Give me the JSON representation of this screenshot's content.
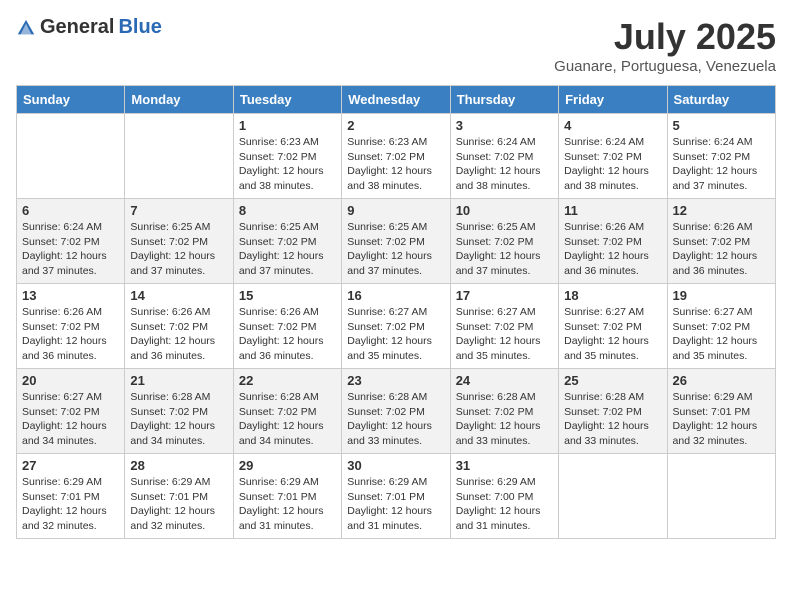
{
  "header": {
    "logo_general": "General",
    "logo_blue": "Blue",
    "month_title": "July 2025",
    "location": "Guanare, Portuguesa, Venezuela"
  },
  "days_of_week": [
    "Sunday",
    "Monday",
    "Tuesday",
    "Wednesday",
    "Thursday",
    "Friday",
    "Saturday"
  ],
  "weeks": [
    [
      {
        "day": "",
        "sunrise": "",
        "sunset": "",
        "daylight": ""
      },
      {
        "day": "",
        "sunrise": "",
        "sunset": "",
        "daylight": ""
      },
      {
        "day": "1",
        "sunrise": "Sunrise: 6:23 AM",
        "sunset": "Sunset: 7:02 PM",
        "daylight": "Daylight: 12 hours and 38 minutes."
      },
      {
        "day": "2",
        "sunrise": "Sunrise: 6:23 AM",
        "sunset": "Sunset: 7:02 PM",
        "daylight": "Daylight: 12 hours and 38 minutes."
      },
      {
        "day": "3",
        "sunrise": "Sunrise: 6:24 AM",
        "sunset": "Sunset: 7:02 PM",
        "daylight": "Daylight: 12 hours and 38 minutes."
      },
      {
        "day": "4",
        "sunrise": "Sunrise: 6:24 AM",
        "sunset": "Sunset: 7:02 PM",
        "daylight": "Daylight: 12 hours and 38 minutes."
      },
      {
        "day": "5",
        "sunrise": "Sunrise: 6:24 AM",
        "sunset": "Sunset: 7:02 PM",
        "daylight": "Daylight: 12 hours and 37 minutes."
      }
    ],
    [
      {
        "day": "6",
        "sunrise": "Sunrise: 6:24 AM",
        "sunset": "Sunset: 7:02 PM",
        "daylight": "Daylight: 12 hours and 37 minutes."
      },
      {
        "day": "7",
        "sunrise": "Sunrise: 6:25 AM",
        "sunset": "Sunset: 7:02 PM",
        "daylight": "Daylight: 12 hours and 37 minutes."
      },
      {
        "day": "8",
        "sunrise": "Sunrise: 6:25 AM",
        "sunset": "Sunset: 7:02 PM",
        "daylight": "Daylight: 12 hours and 37 minutes."
      },
      {
        "day": "9",
        "sunrise": "Sunrise: 6:25 AM",
        "sunset": "Sunset: 7:02 PM",
        "daylight": "Daylight: 12 hours and 37 minutes."
      },
      {
        "day": "10",
        "sunrise": "Sunrise: 6:25 AM",
        "sunset": "Sunset: 7:02 PM",
        "daylight": "Daylight: 12 hours and 37 minutes."
      },
      {
        "day": "11",
        "sunrise": "Sunrise: 6:26 AM",
        "sunset": "Sunset: 7:02 PM",
        "daylight": "Daylight: 12 hours and 36 minutes."
      },
      {
        "day": "12",
        "sunrise": "Sunrise: 6:26 AM",
        "sunset": "Sunset: 7:02 PM",
        "daylight": "Daylight: 12 hours and 36 minutes."
      }
    ],
    [
      {
        "day": "13",
        "sunrise": "Sunrise: 6:26 AM",
        "sunset": "Sunset: 7:02 PM",
        "daylight": "Daylight: 12 hours and 36 minutes."
      },
      {
        "day": "14",
        "sunrise": "Sunrise: 6:26 AM",
        "sunset": "Sunset: 7:02 PM",
        "daylight": "Daylight: 12 hours and 36 minutes."
      },
      {
        "day": "15",
        "sunrise": "Sunrise: 6:26 AM",
        "sunset": "Sunset: 7:02 PM",
        "daylight": "Daylight: 12 hours and 36 minutes."
      },
      {
        "day": "16",
        "sunrise": "Sunrise: 6:27 AM",
        "sunset": "Sunset: 7:02 PM",
        "daylight": "Daylight: 12 hours and 35 minutes."
      },
      {
        "day": "17",
        "sunrise": "Sunrise: 6:27 AM",
        "sunset": "Sunset: 7:02 PM",
        "daylight": "Daylight: 12 hours and 35 minutes."
      },
      {
        "day": "18",
        "sunrise": "Sunrise: 6:27 AM",
        "sunset": "Sunset: 7:02 PM",
        "daylight": "Daylight: 12 hours and 35 minutes."
      },
      {
        "day": "19",
        "sunrise": "Sunrise: 6:27 AM",
        "sunset": "Sunset: 7:02 PM",
        "daylight": "Daylight: 12 hours and 35 minutes."
      }
    ],
    [
      {
        "day": "20",
        "sunrise": "Sunrise: 6:27 AM",
        "sunset": "Sunset: 7:02 PM",
        "daylight": "Daylight: 12 hours and 34 minutes."
      },
      {
        "day": "21",
        "sunrise": "Sunrise: 6:28 AM",
        "sunset": "Sunset: 7:02 PM",
        "daylight": "Daylight: 12 hours and 34 minutes."
      },
      {
        "day": "22",
        "sunrise": "Sunrise: 6:28 AM",
        "sunset": "Sunset: 7:02 PM",
        "daylight": "Daylight: 12 hours and 34 minutes."
      },
      {
        "day": "23",
        "sunrise": "Sunrise: 6:28 AM",
        "sunset": "Sunset: 7:02 PM",
        "daylight": "Daylight: 12 hours and 33 minutes."
      },
      {
        "day": "24",
        "sunrise": "Sunrise: 6:28 AM",
        "sunset": "Sunset: 7:02 PM",
        "daylight": "Daylight: 12 hours and 33 minutes."
      },
      {
        "day": "25",
        "sunrise": "Sunrise: 6:28 AM",
        "sunset": "Sunset: 7:02 PM",
        "daylight": "Daylight: 12 hours and 33 minutes."
      },
      {
        "day": "26",
        "sunrise": "Sunrise: 6:29 AM",
        "sunset": "Sunset: 7:01 PM",
        "daylight": "Daylight: 12 hours and 32 minutes."
      }
    ],
    [
      {
        "day": "27",
        "sunrise": "Sunrise: 6:29 AM",
        "sunset": "Sunset: 7:01 PM",
        "daylight": "Daylight: 12 hours and 32 minutes."
      },
      {
        "day": "28",
        "sunrise": "Sunrise: 6:29 AM",
        "sunset": "Sunset: 7:01 PM",
        "daylight": "Daylight: 12 hours and 32 minutes."
      },
      {
        "day": "29",
        "sunrise": "Sunrise: 6:29 AM",
        "sunset": "Sunset: 7:01 PM",
        "daylight": "Daylight: 12 hours and 31 minutes."
      },
      {
        "day": "30",
        "sunrise": "Sunrise: 6:29 AM",
        "sunset": "Sunset: 7:01 PM",
        "daylight": "Daylight: 12 hours and 31 minutes."
      },
      {
        "day": "31",
        "sunrise": "Sunrise: 6:29 AM",
        "sunset": "Sunset: 7:00 PM",
        "daylight": "Daylight: 12 hours and 31 minutes."
      },
      {
        "day": "",
        "sunrise": "",
        "sunset": "",
        "daylight": ""
      },
      {
        "day": "",
        "sunrise": "",
        "sunset": "",
        "daylight": ""
      }
    ]
  ]
}
